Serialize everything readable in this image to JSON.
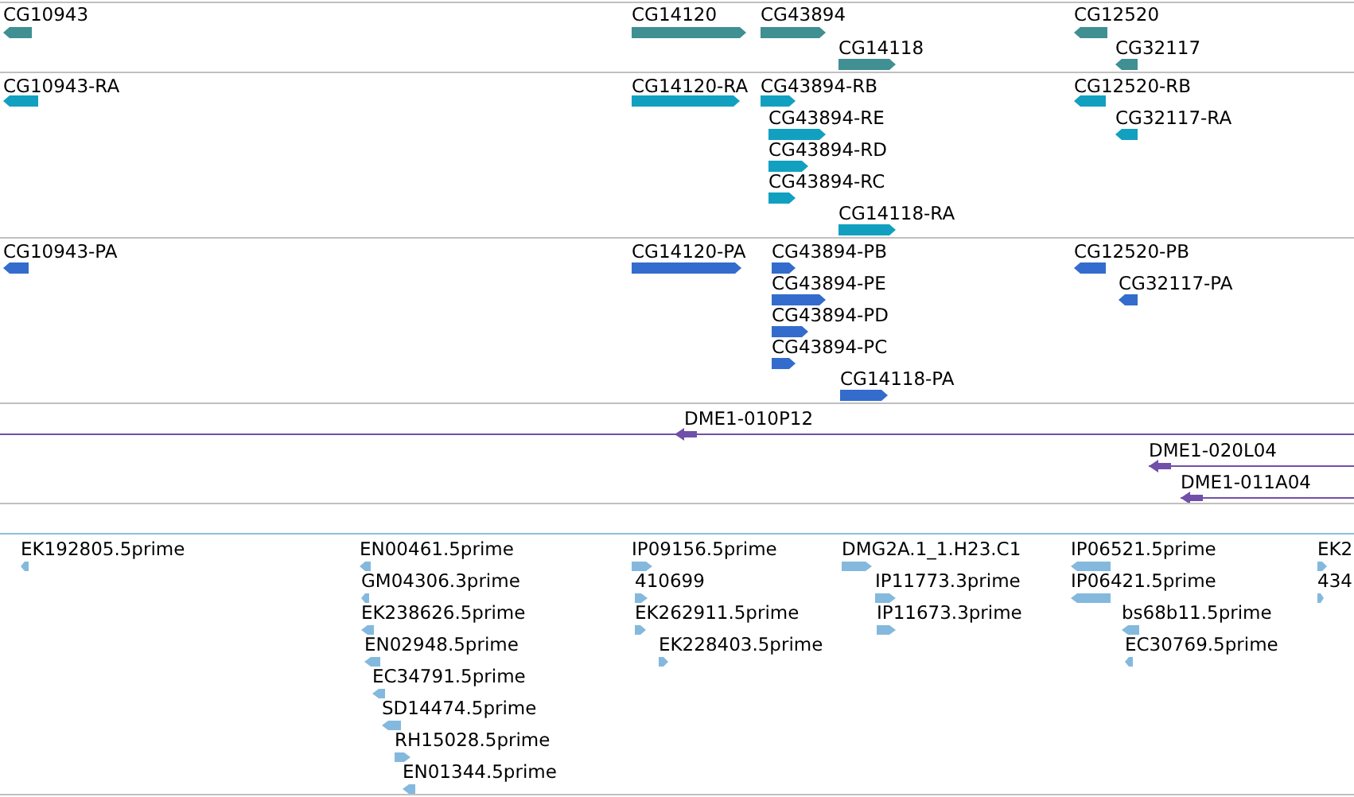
{
  "tracks": [
    {
      "kind": "gene",
      "color": "#3f8f93",
      "features": [
        {
          "label": "CG10943",
          "forward": false
        },
        {
          "label": "CG14120",
          "forward": true
        },
        {
          "label": "CG43894",
          "forward": true
        },
        {
          "label": "CG14118",
          "forward": true
        },
        {
          "label": "CG12520",
          "forward": false
        },
        {
          "label": "CG32117",
          "forward": false
        }
      ]
    },
    {
      "kind": "gene",
      "color": "#12a0c0",
      "features": [
        {
          "label": "CG10943-RA",
          "forward": false
        },
        {
          "label": "CG14120-RA",
          "forward": true
        },
        {
          "label": "CG43894-RB",
          "forward": true
        },
        {
          "label": "CG43894-RE",
          "forward": true
        },
        {
          "label": "CG43894-RD",
          "forward": true
        },
        {
          "label": "CG43894-RC",
          "forward": true
        },
        {
          "label": "CG14118-RA",
          "forward": true
        },
        {
          "label": "CG12520-RB",
          "forward": false
        },
        {
          "label": "CG32117-RA",
          "forward": false
        }
      ]
    },
    {
      "kind": "gene",
      "color": "#336ccc",
      "features": [
        {
          "label": "CG10943-PA",
          "forward": false
        },
        {
          "label": "CG14120-PA",
          "forward": true
        },
        {
          "label": "CG43894-PB",
          "forward": true
        },
        {
          "label": "CG43894-PE",
          "forward": true
        },
        {
          "label": "CG43894-PD",
          "forward": true
        },
        {
          "label": "CG43894-PC",
          "forward": true
        },
        {
          "label": "CG14118-PA",
          "forward": true
        },
        {
          "label": "CG12520-PB",
          "forward": false
        },
        {
          "label": "CG32117-PA",
          "forward": false
        }
      ]
    },
    {
      "kind": "clone",
      "color": "#7050a8",
      "features": [
        {
          "label": "DME1-010P12",
          "forward": false
        },
        {
          "label": "DME1-020L04",
          "forward": false
        },
        {
          "label": "DME1-011A04",
          "forward": false
        }
      ]
    },
    {
      "kind": "est",
      "color": "#84b9dd",
      "features": [
        {
          "label": "EK192805.5prime",
          "forward": false
        },
        {
          "label": "EN00461.5prime",
          "forward": false
        },
        {
          "label": "GM04306.3prime",
          "forward": false
        },
        {
          "label": "EK238626.5prime",
          "forward": false
        },
        {
          "label": "EN02948.5prime",
          "forward": false
        },
        {
          "label": "EC34791.5prime",
          "forward": false
        },
        {
          "label": "SD14474.5prime",
          "forward": false
        },
        {
          "label": "RH15028.5prime",
          "forward": true
        },
        {
          "label": "EN01344.5prime",
          "forward": false
        },
        {
          "label": "IP09156.5prime",
          "forward": true
        },
        {
          "label": "410699",
          "forward": true
        },
        {
          "label": "EK262911.5prime",
          "forward": true
        },
        {
          "label": "EK228403.5prime",
          "forward": true
        },
        {
          "label": "DMG2A.1_1.H23.C1",
          "forward": true
        },
        {
          "label": "IP11773.3prime",
          "forward": true
        },
        {
          "label": "IP11673.3prime",
          "forward": true
        },
        {
          "label": "IP06521.5prime",
          "forward": false
        },
        {
          "label": "IP06421.5prime",
          "forward": false
        },
        {
          "label": "bs68b11.5prime",
          "forward": false
        },
        {
          "label": "EC30769.5prime",
          "forward": false
        },
        {
          "label": "EK2",
          "forward": true
        },
        {
          "label": "434",
          "forward": true
        }
      ]
    }
  ]
}
